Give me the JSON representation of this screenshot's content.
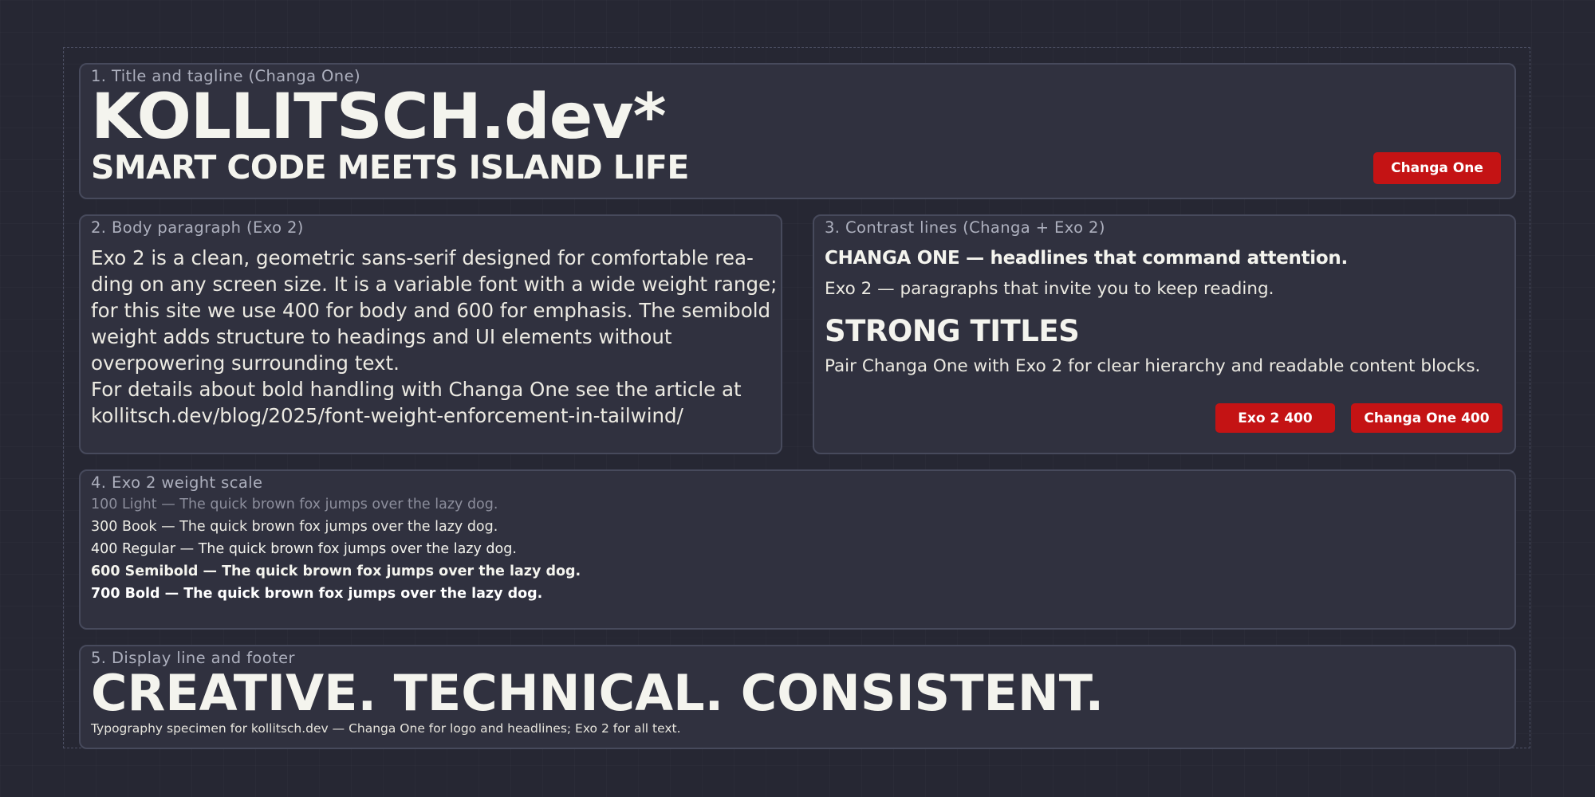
{
  "colors": {
    "background": "#262733",
    "panel": "#30313f",
    "panel_border": "#474a5c",
    "text": "#f4f4ee",
    "label": "#adb0be",
    "badge": "#c41314"
  },
  "panel1": {
    "label": "1. Title and tagline (Changa One)",
    "title": "KOLLITSCH.dev*",
    "tagline": "SMART CODE MEETS ISLAND LIFE",
    "badge": "Changa One"
  },
  "panel2": {
    "label": "2. Body paragraph (Exo 2)",
    "lines": [
      "Exo 2 is a clean, geometric sans-serif designed for comfortable rea-",
      "ding on any screen size. It is a variable font with a wide weight range;",
      "for this site we use 400 for body and 600 for emphasis. The semibold",
      "weight adds structure to headings and UI elements without",
      "overpowering surrounding text.",
      "For details about bold handling with Changa One see the article at",
      "kollitsch.dev/blog/2025/font-weight-enforcement-in-tailwind/"
    ]
  },
  "panel3": {
    "label": "3. Contrast lines (Changa + Exo 2)",
    "headline": "CHANGA ONE — headlines that command attention.",
    "body_line": "Exo 2 — paragraphs that invite you to keep reading.",
    "strong_title": "STRONG TITLES",
    "pair_line": "Pair Changa One with Exo 2 for clear hierarchy and readable content blocks.",
    "badges": [
      "Exo 2 400",
      "Changa One 400"
    ]
  },
  "panel4": {
    "label": "4. Exo 2 weight scale",
    "weights": [
      {
        "text": "100 Light — The quick brown fox jumps over the lazy dog.",
        "color": "#8c8e9c"
      },
      {
        "text": "300 Book — The quick brown fox jumps over the lazy dog.",
        "color": "#ecebe4"
      },
      {
        "text": "400 Regular — The quick brown fox jumps over the lazy dog.",
        "color": "#f4f4ee"
      },
      {
        "text": "600 Semibold — The quick brown fox jumps over the lazy dog.",
        "color": "#f4f4ee"
      },
      {
        "text": "700 Bold — The quick brown fox jumps over the lazy dog.",
        "color": "#ffffff"
      }
    ]
  },
  "panel5": {
    "label": "5. Display line and footer",
    "display": "CREATIVE. TECHNICAL. CONSISTENT.",
    "footer": "Typography specimen for kollitsch.dev — Changa One for logo and headlines; Exo 2 for all text."
  }
}
